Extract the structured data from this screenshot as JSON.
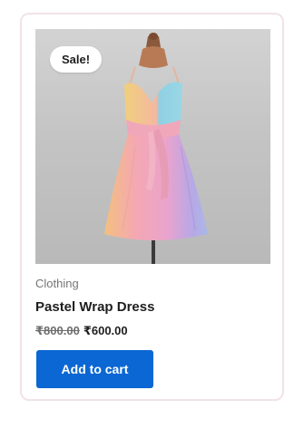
{
  "product": {
    "badge": "Sale!",
    "category": "Clothing",
    "name": "Pastel Wrap Dress",
    "regular_price": "₹800.00",
    "sale_price": "₹600.00",
    "add_to_cart_label": "Add to cart",
    "image_icon": "dress-on-mannequin-image"
  },
  "colors": {
    "accent": "#0a67d3",
    "card_border": "#f1e3e8"
  }
}
